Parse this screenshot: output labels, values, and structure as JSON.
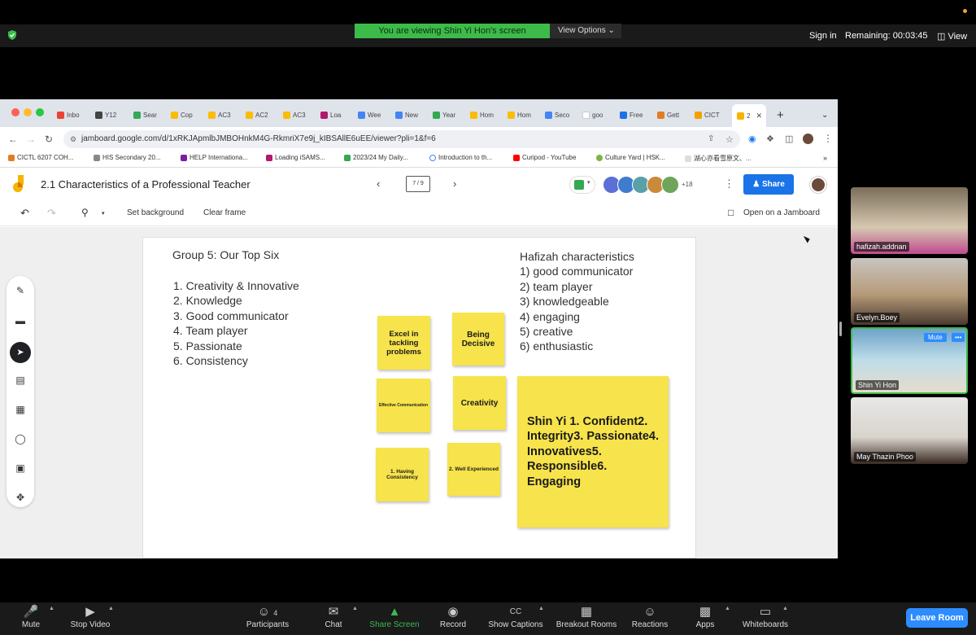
{
  "zoom": {
    "viewing_banner": "You are viewing Shin Yi Hon's screen",
    "view_options": "View Options",
    "sign_in": "Sign in",
    "remaining": "Remaining: 00:03:45",
    "view": "View",
    "leave": "Leave Room",
    "controls": [
      {
        "label": "Mute",
        "icon": "mic-icon"
      },
      {
        "label": "Stop Video",
        "icon": "video-icon"
      },
      {
        "label": "Participants",
        "icon": "participants-icon",
        "badge": "4"
      },
      {
        "label": "Chat",
        "icon": "chat-icon"
      },
      {
        "label": "Share Screen",
        "icon": "share-screen-icon"
      },
      {
        "label": "Record",
        "icon": "record-icon"
      },
      {
        "label": "Show Captions",
        "icon": "captions-icon"
      },
      {
        "label": "Breakout Rooms",
        "icon": "breakout-icon"
      },
      {
        "label": "Reactions",
        "icon": "reactions-icon"
      },
      {
        "label": "Apps",
        "icon": "apps-icon"
      },
      {
        "label": "Whiteboards",
        "icon": "whiteboard-icon"
      }
    ],
    "participants": [
      {
        "name": "hafizah.addnan"
      },
      {
        "name": "Evelyn.Boey"
      },
      {
        "name": "Shin Yi Hon",
        "mute": "Mute",
        "more": "•••"
      },
      {
        "name": "May Thazin Phoo"
      }
    ]
  },
  "browser": {
    "tabs": [
      "Inbo",
      "Y12",
      "Sear",
      "Cop",
      "AC3",
      "AC2",
      "AC3",
      "Loa",
      "Wee",
      "New",
      "Year",
      "Hom",
      "Hom",
      "Seco",
      "goo",
      "Free",
      "Gett",
      "CICT",
      "2"
    ],
    "url": "jamboard.google.com/d/1xRKJApmlbJMBOHnkM4G-RkmriX7e9j_kIBSAllE6uEE/viewer?pli=1&f=6",
    "bookmarks": [
      "CICTL 6207 COH...",
      "HIS Secondary 20...",
      "HELP Internationa...",
      "Loading iSAMS...",
      "2023/24 My Daily...",
      "Introduction to th...",
      "Curipod - YouTube",
      "Culture Yard | HSK...",
      "湖心亦看雪原文、..."
    ]
  },
  "jamboard": {
    "title": "2.1 Characteristics of a Professional Teacher",
    "frame_indicator": "7 / 9",
    "collaborators_extra": "+18",
    "share": "Share",
    "set_background": "Set background",
    "clear_frame": "Clear frame",
    "open_on_jamboard": "Open on a Jamboard",
    "group_title": "Group 5: Our Top Six",
    "group_items": [
      "1. Creativity & Innovative",
      "2. Knowledge",
      "3. Good communicator",
      "4. Team player",
      "5. Passionate",
      "6. Consistency"
    ],
    "hafizah_title": "Hafizah characteristics",
    "hafizah_items": [
      "1) good communicator",
      "2) team player",
      "3) knowledgeable",
      "4) engaging",
      "5) creative",
      "6) enthusiastic"
    ],
    "stickies": {
      "excel": "Excel in tackling problems",
      "decisive": "Being Decisive",
      "effective": "Effective Communication",
      "creativity": "Creativity",
      "consistency": "1. Having Consistency",
      "experienced": "2. Well Experienced",
      "shinyi": "Shin Yi 1. Confident2. Integrity3. Passionate4. Innovatives5. Responsible6. Engaging"
    }
  }
}
